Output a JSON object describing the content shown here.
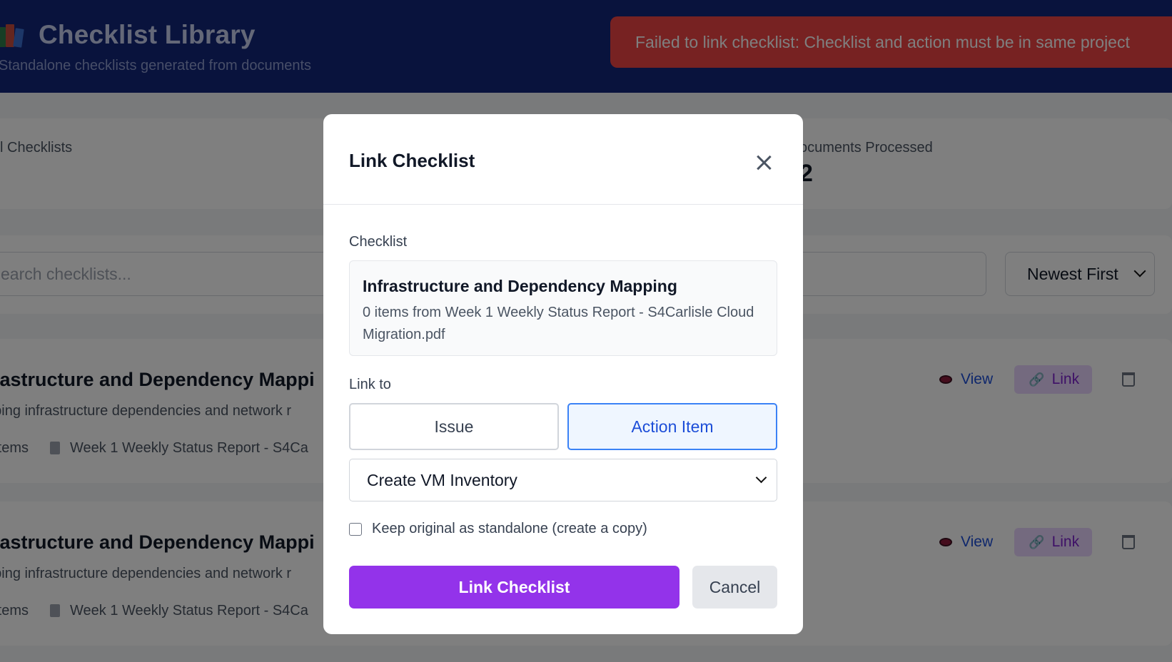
{
  "header": {
    "title": "Checklist Library",
    "title_icon": "books-icon",
    "subtitle": "Standalone checklists generated from documents"
  },
  "toast": {
    "message": "Failed to link checklist: Checklist and action must be in same project",
    "color": "#ef4444"
  },
  "stats": [
    {
      "label": "l Checklists",
      "value": ""
    },
    {
      "label": "ocuments Processed",
      "value": "2"
    }
  ],
  "search": {
    "placeholder": "earch checklists...",
    "sort_value": "Newest First"
  },
  "cards": [
    {
      "title": "frastructure and Dependency Mappi",
      "description": "pping infrastructure dependencies and network r",
      "items": ") items",
      "document": "Week 1 Weekly Status Report - S4Ca",
      "view_label": "View",
      "link_label": "Link"
    },
    {
      "title": "frastructure and Dependency Mappi",
      "description": "pping infrastructure dependencies and network r",
      "items": ") items",
      "document": "Week 1 Weekly Status Report - S4Ca",
      "view_label": "View",
      "link_label": "Link"
    }
  ],
  "modal": {
    "title": "Link Checklist",
    "checklist_label": "Checklist",
    "checklist": {
      "title": "Infrastructure and Dependency Mapping",
      "subtitle": "0 items from Week 1 Weekly Status Report - S4Carlisle Cloud Migration.pdf"
    },
    "link_to_label": "Link to",
    "type_options": [
      {
        "label": "Issue",
        "selected": false
      },
      {
        "label": "Action Item",
        "selected": true
      }
    ],
    "target_value": "Create VM Inventory",
    "keep_original_label": "Keep original as standalone (create a copy)",
    "keep_original_checked": false,
    "submit_label": "Link Checklist",
    "cancel_label": "Cancel"
  },
  "colors": {
    "header_bg": "#13267a",
    "primary": "#9333ea",
    "accent": "#3b82f6",
    "toast": "#ef4444"
  }
}
